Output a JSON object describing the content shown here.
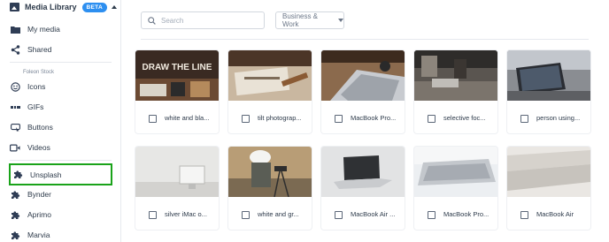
{
  "sidebar": {
    "header_title": "Media Library",
    "beta_badge": "BETA",
    "items_top": [
      {
        "label": "My media",
        "icon": "folder-icon"
      },
      {
        "label": "Shared",
        "icon": "share-icon"
      }
    ],
    "section_caption": "Foleon Stock",
    "items_stock": [
      {
        "label": "Icons",
        "icon": "smiley-icon"
      },
      {
        "label": "GIFs",
        "icon": "gif-icon"
      },
      {
        "label": "Buttons",
        "icon": "button-icon"
      },
      {
        "label": "Videos",
        "icon": "video-icon"
      }
    ],
    "items_plugins": [
      {
        "label": "Unsplash",
        "icon": "puzzle-icon"
      },
      {
        "label": "Bynder",
        "icon": "puzzle-icon"
      },
      {
        "label": "Aprimo",
        "icon": "puzzle-icon"
      },
      {
        "label": "Marvia",
        "icon": "puzzle-icon"
      }
    ]
  },
  "toolbar": {
    "search_placeholder": "Search",
    "category_selected": "Business & Work"
  },
  "cards_row1": [
    {
      "label": "white and bla...",
      "thumb_text": "DRAW THE LINE"
    },
    {
      "label": "tilt photograp..."
    },
    {
      "label": "MacBook Pro..."
    },
    {
      "label": "selective foc..."
    },
    {
      "label": "person using..."
    }
  ],
  "cards_row2": [
    {
      "label": "silver iMac o..."
    },
    {
      "label": "white and gr..."
    },
    {
      "label": "MacBook Air ..."
    },
    {
      "label": "MacBook Pro..."
    },
    {
      "label": "MacBook Air"
    }
  ],
  "colors": {
    "accent": "#2d8ff0",
    "selection_outline": "#1aa31a",
    "text": "#2d3a4a"
  }
}
